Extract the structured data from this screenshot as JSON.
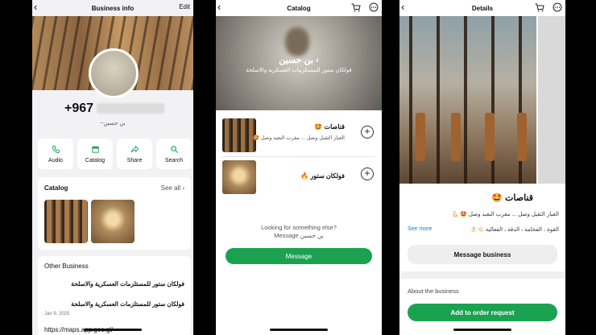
{
  "panel1": {
    "title": "Business info",
    "edit": "Edit",
    "phone": "+967",
    "name": "~بن حسين",
    "actions": [
      {
        "label": "Audio",
        "icon": "phone-icon"
      },
      {
        "label": "Catalog",
        "icon": "shop-icon"
      },
      {
        "label": "Share",
        "icon": "share-icon"
      },
      {
        "label": "Search",
        "icon": "search-icon"
      }
    ],
    "catalog_title": "Catalog",
    "see_all": "See all",
    "other_title": "Other Business",
    "other_items": [
      "فولكان ستور للمستلزمات العسكرية والاسلحة",
      "فولكان ستور للمستلزمات العسكرية والاسلحة"
    ],
    "other_date": "Jan 9, 2025",
    "maps": "https://maps.app.goo.gl/"
  },
  "panel2": {
    "title": "Catalog",
    "owner": "بن حسين ‹",
    "owner_sub": "فولكان ستور للمستلزمات العسكرية والاسلحة",
    "items": [
      {
        "title": "قناصات 🤩",
        "desc": "العيار الثقيل وصل ... مقرب البعيد وصل 🤩"
      },
      {
        "title": "فولكان ستور 🔥",
        "desc": ""
      }
    ],
    "looking": "Looking for something else?",
    "message_owner": "Message بن حسين",
    "message_button": "Message"
  },
  "panel3": {
    "title": "Details",
    "product_title": "قناصات 🤩",
    "desc": "العيار الثقيل وصل ... مقرب البعيد وصل 🤩 💪🏻",
    "see_more": "See more",
    "desc2": "القوة ، الفخامة ، الدقة ، الفعالية 👈🏻👌🏻",
    "message_business": "Message business",
    "about": "About the business",
    "add_button": "Add to order request"
  },
  "colors": {
    "green": "#1aa251",
    "link": "#1a7ec2"
  }
}
